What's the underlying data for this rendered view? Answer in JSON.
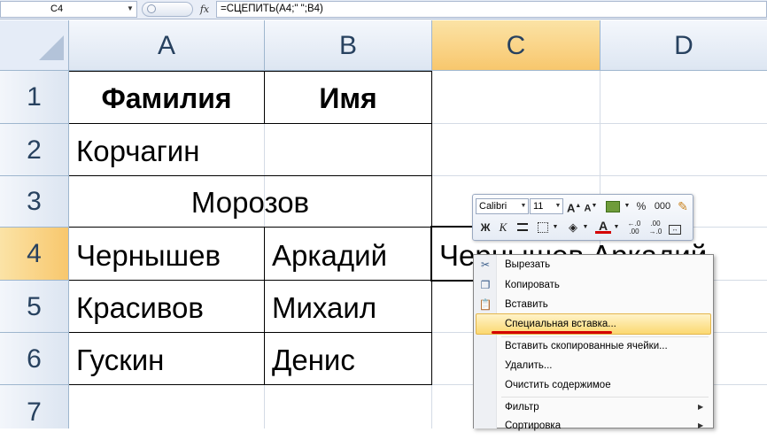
{
  "formula_bar": {
    "name_box": "C4",
    "fx_label": "fx",
    "formula": "=СЦЕПИТЬ(A4;\" \";B4)"
  },
  "columns": [
    "A",
    "B",
    "C",
    "D"
  ],
  "rows": [
    "1",
    "2",
    "3",
    "4",
    "5",
    "6",
    "7"
  ],
  "cells": {
    "A1": "Фамилия",
    "B1": "Имя",
    "A2": "Корчагин",
    "A3": "Морозов",
    "A4": "Чернышев",
    "B4": "Аркадий",
    "C4": "Чернышев Аркадий",
    "A5": "Красивов",
    "B5": "Михаил",
    "A6": "Гускин",
    "B6": "Денис"
  },
  "mini_toolbar": {
    "font": "Calibri",
    "size": "11",
    "grow": "A",
    "shrink": "A",
    "percent": "%",
    "thousands": "000",
    "bold": "Ж",
    "italic": "К",
    "font_color": "A"
  },
  "context_menu": {
    "items": [
      {
        "label": "Вырезать",
        "icon": "scissors-icon"
      },
      {
        "label": "Копировать",
        "icon": "copy-icon"
      },
      {
        "label": "Вставить",
        "icon": "paste-icon"
      },
      {
        "label": "Специальная вставка...",
        "highlighted": true
      },
      {
        "label": "Вставить скопированные ячейки..."
      },
      {
        "label": "Удалить..."
      },
      {
        "label": "Очистить содержимое"
      },
      {
        "label": "Фильтр",
        "submenu": true
      },
      {
        "label": "Сортировка",
        "submenu": true
      }
    ]
  },
  "colors": {
    "header_selected": "#f8c76d",
    "header_bg": "#dde6f2",
    "menu_highlight": "#fbd871",
    "annotation_underline": "#d40000"
  }
}
